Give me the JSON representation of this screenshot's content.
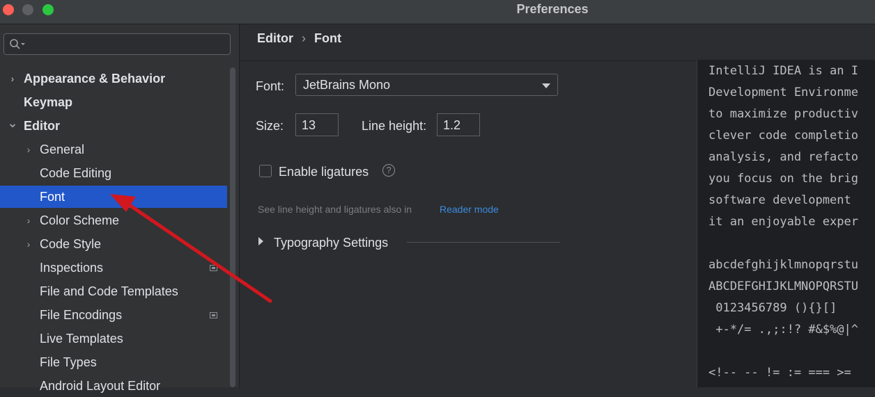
{
  "window": {
    "title": "Preferences"
  },
  "sidebar": {
    "search_placeholder": "",
    "items": [
      {
        "label": "Appearance & Behavior",
        "expandable": true,
        "expanded": false,
        "bold": true,
        "indent": 0
      },
      {
        "label": "Keymap",
        "expandable": false,
        "bold": true,
        "indent": 0
      },
      {
        "label": "Editor",
        "expandable": true,
        "expanded": true,
        "bold": true,
        "indent": 0
      },
      {
        "label": "General",
        "expandable": true,
        "expanded": false,
        "indent": 1
      },
      {
        "label": "Code Editing",
        "expandable": false,
        "indent": 1
      },
      {
        "label": "Font",
        "expandable": false,
        "indent": 1,
        "selected": true
      },
      {
        "label": "Color Scheme",
        "expandable": true,
        "expanded": false,
        "indent": 1
      },
      {
        "label": "Code Style",
        "expandable": true,
        "expanded": false,
        "indent": 1
      },
      {
        "label": "Inspections",
        "expandable": false,
        "indent": 1,
        "has_icon": true
      },
      {
        "label": "File and Code Templates",
        "expandable": false,
        "indent": 1
      },
      {
        "label": "File Encodings",
        "expandable": false,
        "indent": 1,
        "has_icon": true
      },
      {
        "label": "Live Templates",
        "expandable": false,
        "indent": 1
      },
      {
        "label": "File Types",
        "expandable": false,
        "indent": 1
      },
      {
        "label": "Android Layout Editor",
        "expandable": false,
        "indent": 1
      }
    ]
  },
  "breadcrumb": {
    "parent": "Editor",
    "separator": "›",
    "current": "Font"
  },
  "settings": {
    "font_label": "Font:",
    "font_value": "JetBrains Mono",
    "size_label": "Size:",
    "size_value": "13",
    "line_height_label": "Line height:",
    "line_height_value": "1.2",
    "ligatures_label": "Enable ligatures",
    "ligatures_checked": false,
    "help_glyph": "?",
    "hint_text": "See line height and ligatures also in",
    "hint_link": "Reader mode",
    "typography_label": "Typography Settings"
  },
  "preview": {
    "lines": [
      "IntelliJ IDEA is an I",
      "Development Environme",
      "to maximize productiv",
      "clever code completio",
      "analysis, and refacto",
      "you focus on the brig",
      "software development ",
      "it an enjoyable exper",
      "",
      "abcdefghijklmnopqrstu",
      "ABCDEFGHIJKLMNOPQRSTU",
      " 0123456789 (){}[]",
      " +-*/= .,;:!? #&$%@|^",
      "",
      "<!-- -- != := === >= "
    ]
  },
  "colors": {
    "accent": "#2257c9",
    "annotation_arrow": "#d0181e",
    "link": "#3d8be0"
  }
}
